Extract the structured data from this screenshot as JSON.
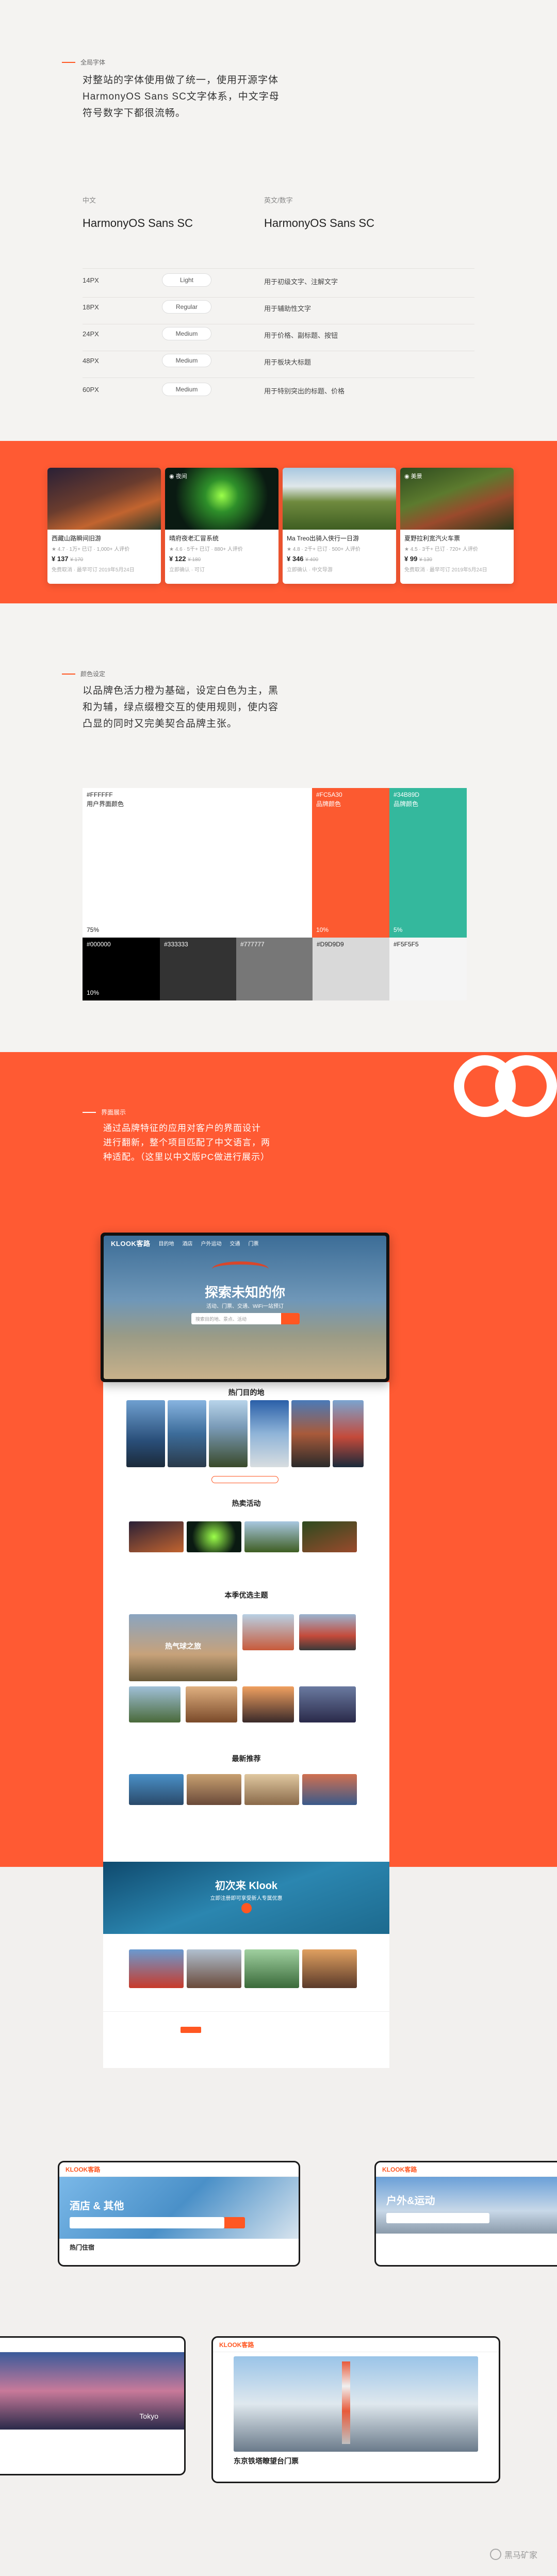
{
  "typography": {
    "section_label": "全局字体",
    "intro": [
      "对整站的字体使用做了统一，使用开源字体",
      "HarmonyOS Sans SC文字体系，中文字母",
      "符号数字下都很流畅。"
    ],
    "cn_head_small": "中文",
    "cn_head_big": "HarmonyOS Sans SC",
    "en_head_small": "英文/数字",
    "en_head_big": "HarmonyOS Sans SC",
    "rows": [
      {
        "size": "14PX",
        "weight": "Light",
        "use": "用于初级文字、注解文字"
      },
      {
        "size": "18PX",
        "weight": "Regular",
        "use": "用于辅助性文字"
      },
      {
        "size": "24PX",
        "weight": "Medium",
        "use": "用于价格、副标题、按钮"
      },
      {
        "size": "48PX",
        "weight": "Medium",
        "use": "用于板块大标题"
      },
      {
        "size": "60PX",
        "weight": "Medium",
        "use": "用于特别突出的标题、价格"
      }
    ]
  },
  "cards": [
    {
      "tag": "",
      "title": "西藏山路瞬间旧游",
      "meta": "★ 4.7 · 1万+ 已订 · 1,000+ 人评价",
      "price": "¥ 137",
      "orig": "¥ 170",
      "foot": "免费取消 · 最早可订 2019年5月24日"
    },
    {
      "tag": "◉ 夜间",
      "title": "晴府夜老汇冒系统",
      "meta": "★ 4.6 · 5千+ 已订 · 880+ 人评价",
      "price": "¥ 122",
      "orig": "¥ 180",
      "foot": "立即确认 · 可订"
    },
    {
      "tag": "",
      "title": "Ma Treo出骑入侠行一日游",
      "meta": "★ 4.8 · 2千+ 已订 · 500+ 人评价",
      "price": "¥ 346",
      "orig": "¥ 400",
      "foot": "立即确认 · 中文导游"
    },
    {
      "tag": "◉ 美景",
      "title": "夏野拉利宽汽火车票",
      "meta": "★ 4.5 · 3千+ 已订 · 720+ 人评价",
      "price": "¥ 99",
      "orig": "¥ 130",
      "foot": "免费取消 · 最早可订 2019年5月24日"
    }
  ],
  "colors": {
    "section_label": "颜色设定",
    "intro": [
      "以品牌色活力橙为基础，设定白色为主，黑",
      "和为辅，绿点缀橙交互的使用规则，使内容",
      "凸显的同时又完美契合品牌主张。"
    ],
    "swatches": [
      {
        "code": "#FFFFFF",
        "name": "用户界面颜色",
        "pct": "75%"
      },
      {
        "code": "#FC5A30",
        "name": "品牌颜色",
        "pct": "10%"
      },
      {
        "code": "#34B89D",
        "name": "品牌颜色",
        "pct": "5%"
      },
      {
        "code": "#000000",
        "name": "",
        "pct": "10%"
      },
      {
        "code": "#333333",
        "name": "",
        "pct": ""
      },
      {
        "code": "#777777",
        "name": "",
        "pct": ""
      },
      {
        "code": "#D9D9D9",
        "name": "",
        "pct": ""
      },
      {
        "code": "#F5F5F5",
        "name": "",
        "pct": ""
      }
    ],
    "accent": "#FC5A30",
    "green": "#34B89D"
  },
  "interface": {
    "section_label": "界面展示",
    "intro": [
      "通过品牌特征的应用对客户的界面设计",
      "进行翻新，整个项目匹配了中文语言，两",
      "种适配。（这里以中文版PC做进行展示）"
    ],
    "logo": "KLOOK客路",
    "nav": [
      "目的地",
      "酒店",
      "户外运动",
      "交通",
      "门票"
    ],
    "hero_title": "探索未知的你",
    "hero_sub": "活动、门票、交通、WiFi一站预订",
    "search_placeholder": "搜索目的地、景点、活动",
    "sections": [
      "热门目的地",
      "热卖活动",
      "本季优选主题",
      "最新推荐"
    ],
    "theme_label": "热气球之旅",
    "blue_title": "初次来 Klook",
    "blue_sub": "立即注册即可享受新人专属优惠"
  },
  "bottom": {
    "screen1_logo": "KLOOK客路",
    "screen1_title": "酒店 & 其他",
    "screen1_section": "热门住宿",
    "screen2_logo": "KLOOK客路",
    "screen2_title": "户外&运动",
    "screen3_city": "Tokyo",
    "screen4_logo": "KLOOK客路",
    "screen4_title": "东京铁塔瞭望台门票",
    "watermark": "黑马矿家"
  }
}
